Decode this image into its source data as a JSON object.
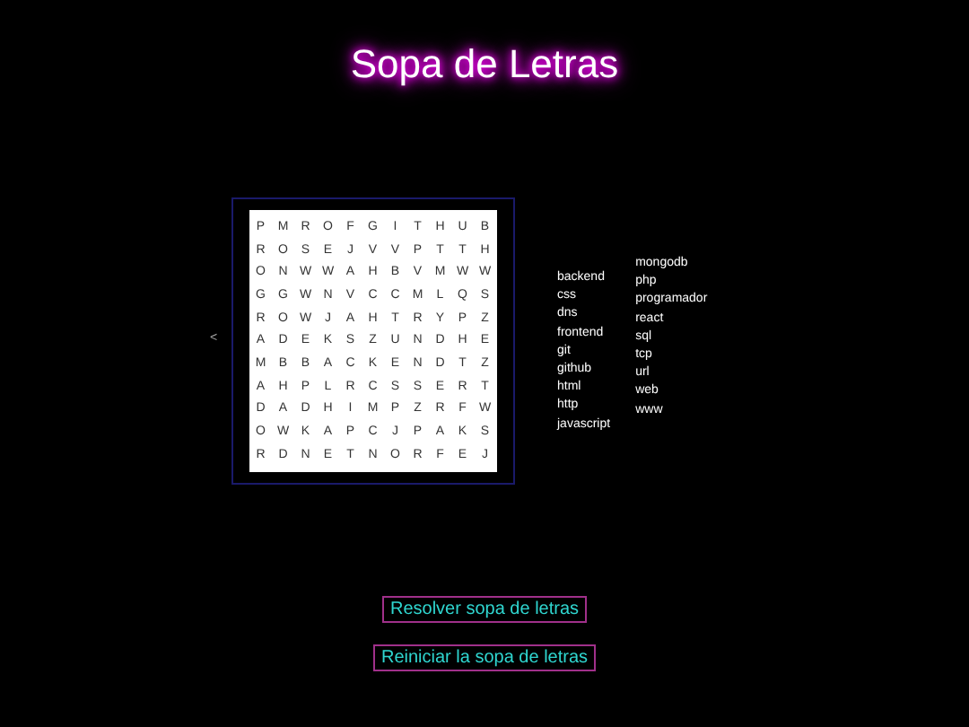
{
  "title": "Sopa de Letras",
  "nav_symbol": "<",
  "grid": [
    [
      "P",
      "M",
      "R",
      "O",
      "F",
      "G",
      "I",
      "T",
      "H",
      "U",
      "B"
    ],
    [
      "R",
      "O",
      "S",
      "E",
      "J",
      "V",
      "V",
      "P",
      "T",
      "T",
      "H"
    ],
    [
      "O",
      "N",
      "W",
      "W",
      "A",
      "H",
      "B",
      "V",
      "M",
      "W",
      "W"
    ],
    [
      "G",
      "G",
      "W",
      "N",
      "V",
      "C",
      "C",
      "M",
      "L",
      "Q",
      "S"
    ],
    [
      "R",
      "O",
      "W",
      "J",
      "A",
      "H",
      "T",
      "R",
      "Y",
      "P",
      "Z"
    ],
    [
      "A",
      "D",
      "E",
      "K",
      "S",
      "Z",
      "U",
      "N",
      "D",
      "H",
      "E"
    ],
    [
      "M",
      "B",
      "B",
      "A",
      "C",
      "K",
      "E",
      "N",
      "D",
      "T",
      "Z"
    ],
    [
      "A",
      "H",
      "P",
      "L",
      "R",
      "C",
      "S",
      "S",
      "E",
      "R",
      "T"
    ],
    [
      "D",
      "A",
      "D",
      "H",
      "I",
      "M",
      "P",
      "Z",
      "R",
      "F",
      "W"
    ],
    [
      "O",
      "W",
      "K",
      "A",
      "P",
      "C",
      "J",
      "P",
      "A",
      "K",
      "S"
    ],
    [
      "R",
      "D",
      "N",
      "E",
      "T",
      "N",
      "O",
      "R",
      "F",
      "E",
      "J"
    ]
  ],
  "word_columns": [
    [
      "backend",
      "css",
      "dns",
      "frontend",
      "git",
      "github",
      "html",
      "http",
      "javascript"
    ],
    [
      "mongodb",
      "php",
      "programador",
      "react",
      "sql",
      "tcp",
      "url",
      "web",
      "www"
    ]
  ],
  "buttons": [
    "Resolver sopa de letras",
    "Reiniciar la sopa de letras"
  ]
}
